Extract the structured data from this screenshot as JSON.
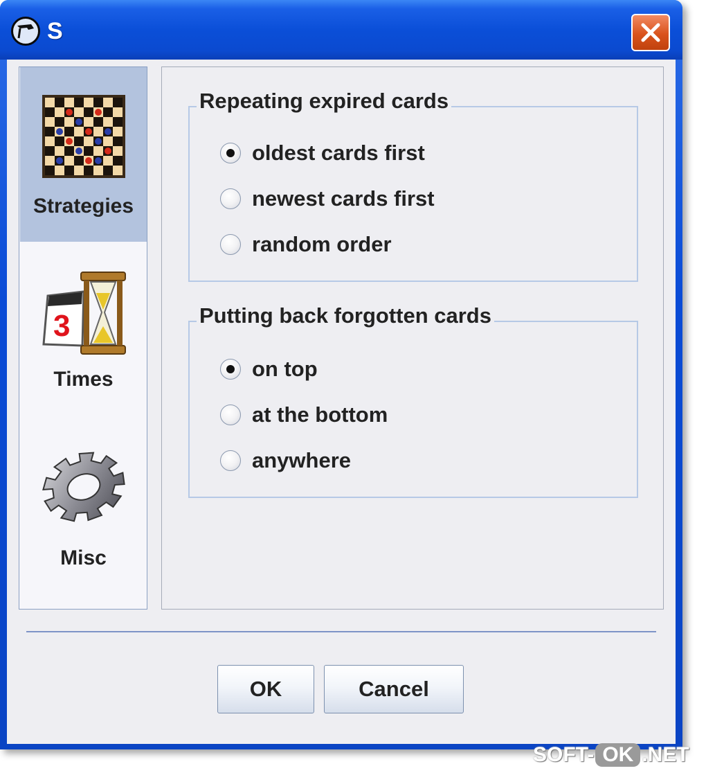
{
  "window": {
    "title": "S"
  },
  "sidebar": {
    "items": [
      {
        "label": "Strategies",
        "icon": "chessboard-icon",
        "selected": true
      },
      {
        "label": "Times",
        "icon": "calendar-hourglass-icon",
        "calendar_number": "3",
        "selected": false
      },
      {
        "label": "Misc",
        "icon": "gear-icon",
        "selected": false
      }
    ]
  },
  "groups": [
    {
      "title": "Repeating expired cards",
      "options": [
        {
          "label": "oldest cards first",
          "selected": true
        },
        {
          "label": "newest cards first",
          "selected": false
        },
        {
          "label": "random order",
          "selected": false
        }
      ]
    },
    {
      "title": "Putting back forgotten cards",
      "options": [
        {
          "label": "on top",
          "selected": true
        },
        {
          "label": "at the bottom",
          "selected": false
        },
        {
          "label": "anywhere",
          "selected": false
        }
      ]
    }
  ],
  "buttons": {
    "ok": "OK",
    "cancel": "Cancel"
  },
  "watermark": {
    "left": "SOFT-",
    "middle": "OK",
    "right": ".NET"
  },
  "colors": {
    "titlebar": "#0b4fd8",
    "selected_item": "#b3c3de",
    "close_button": "#d9531c"
  }
}
